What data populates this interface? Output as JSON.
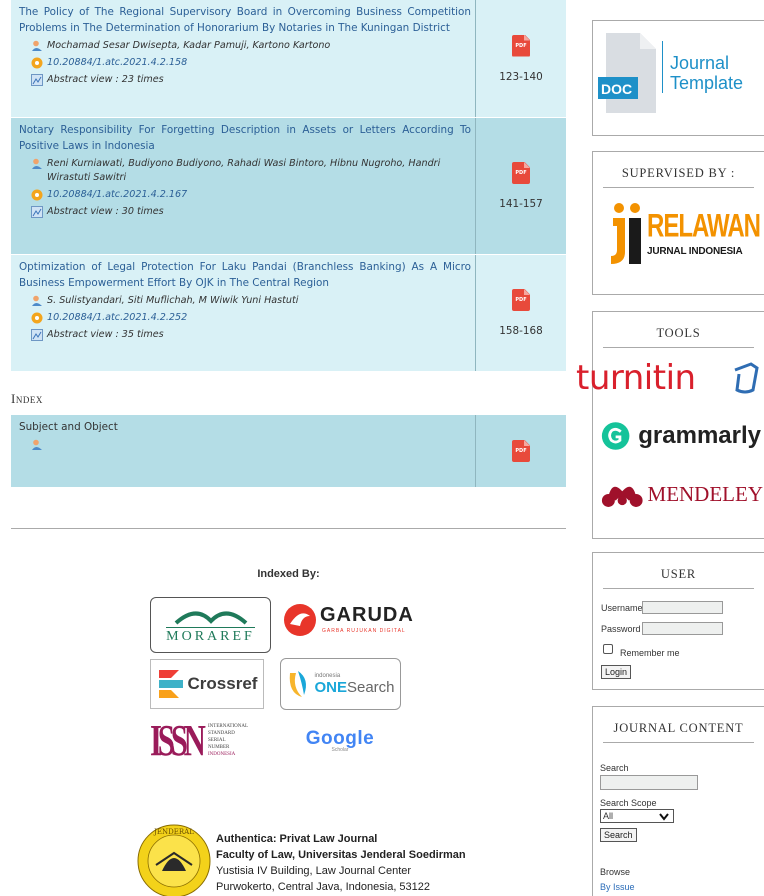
{
  "articles": [
    {
      "title": "The Policy of The Regional Supervisory Board in Overcoming Business Competition Problems in The Determination of Honorarium By Notaries in The Kuningan District",
      "authors": "Mochamad Sesar Dwisepta, Kadar Pamuji, Kartono Kartono",
      "doi": "10.20884/1.atc.2021.4.2.158",
      "views": "Abstract view : 23 times",
      "pages": "123-140",
      "pdf": "PDF"
    },
    {
      "title": "Notary Responsibility For Forgetting Description in Assets or Letters According To Positive Laws in Indonesia",
      "authors": "Reni Kurniawati, Budiyono Budiyono, Rahadi Wasi Bintoro, Hibnu Nugroho, Handri Wirastuti Sawitri",
      "doi": "10.20884/1.atc.2021.4.2.167",
      "views": "Abstract view : 30 times",
      "pages": "141-157",
      "pdf": "PDF"
    },
    {
      "title": "Optimization of Legal Protection For Laku Pandai (Branchless Banking) As A Micro Business Empowerment Effort By OJK in The Central Region",
      "authors": "S. Sulistyandari, Siti Muflichah, M Wiwik Yuni Hastuti",
      "doi": "10.20884/1.atc.2021.4.2.252",
      "views": "Abstract view : 35 times",
      "pages": "158-168",
      "pdf": "PDF"
    }
  ],
  "index_section": {
    "heading": "Index",
    "item_title": "Subject and Object",
    "pdf": "PDF"
  },
  "indexed_by": {
    "label": "Indexed By:",
    "logos": {
      "moraref": "MORAREF",
      "garuda": "GARUDA",
      "garuda_sub": "GARBA RUJUKAN DIGITAL",
      "crossref": "Crossref",
      "onesearch_pre": "indonesia",
      "onesearch_one": "ONE",
      "onesearch_search": "Search",
      "issn_letters": "ISSN",
      "issn_lines": [
        "INTERNATIONAL",
        "STANDARD",
        "SERIAL",
        "NUMBER",
        "INDONESIA"
      ],
      "google": "Google",
      "google_sub": "Scholar"
    }
  },
  "footer": {
    "journal": "Authentica: Privat Law Journal",
    "faculty": "Faculty of Law, Universitas Jenderal Soedirman",
    "building": "Yustisia IV Building, Law Journal Center",
    "city": "Purwokerto, Central Java, Indonesia, 53122",
    "seal_text": "JENDERAL"
  },
  "sidebar": {
    "template": {
      "doc": "DOC",
      "line1": "Journal",
      "line2": "Template"
    },
    "supervised": {
      "title": "SUPERVISED BY :",
      "rji1": "RELAWAN",
      "rji2": "JURNAL INDONESIA"
    },
    "tools": {
      "title": "TOOLS",
      "turnitin": "turnitin",
      "grammarly": "grammarly",
      "mendeley": "MENDELEY"
    },
    "user": {
      "title": "USER",
      "username_label": "Username",
      "password_label": "Password",
      "remember_label": "Remember me",
      "login_label": "Login"
    },
    "journal_content": {
      "title": "JOURNAL CONTENT",
      "search_label": "Search",
      "scope_label": "Search Scope",
      "scope_value": "All",
      "search_button": "Search",
      "browse_label": "Browse",
      "by_issue": "By Issue"
    }
  },
  "colors": {
    "row_light": "#d9f1f6",
    "row_dark": "#b4dde6",
    "link": "#2b5f96",
    "pdf_red": "#e84a3b"
  }
}
